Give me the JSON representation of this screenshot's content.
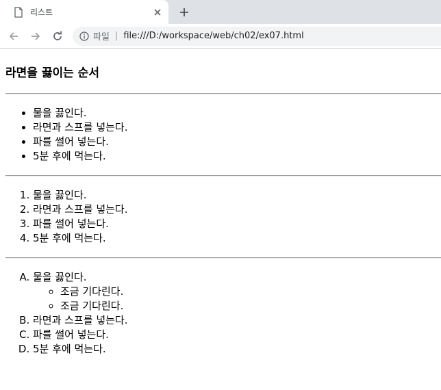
{
  "browser": {
    "tab_title": "리스트",
    "omnibox_scheme": "파일",
    "omnibox_separator": "|",
    "url": "file:///D:/workspace/web/ch02/ex07.html"
  },
  "page": {
    "heading": "라면을 끓이는 순서",
    "unordered_list": [
      "물을 끓인다.",
      "라면과 스프를 넣는다.",
      "파를 썰어 넣는다.",
      "5분 후에 먹는다."
    ],
    "ordered_list": [
      "물을 끓인다.",
      "라면과 스프를 넣는다.",
      "파를 썰어 넣는다.",
      "5분 후에 먹는다."
    ],
    "alpha_list": [
      "물을 끓인다.",
      "라면과 스프를 넣는다.",
      "파를 썰어 넣는다.",
      "5분 후에 먹는다."
    ],
    "nested_list": [
      "조금 기다린다.",
      "조금 기다린다."
    ]
  },
  "icons": {
    "tab_icon": "document-icon",
    "close": "close-icon",
    "new_tab": "plus-icon",
    "back": "arrow-left-icon",
    "forward": "arrow-right-icon",
    "reload": "reload-icon",
    "info": "info-icon"
  }
}
